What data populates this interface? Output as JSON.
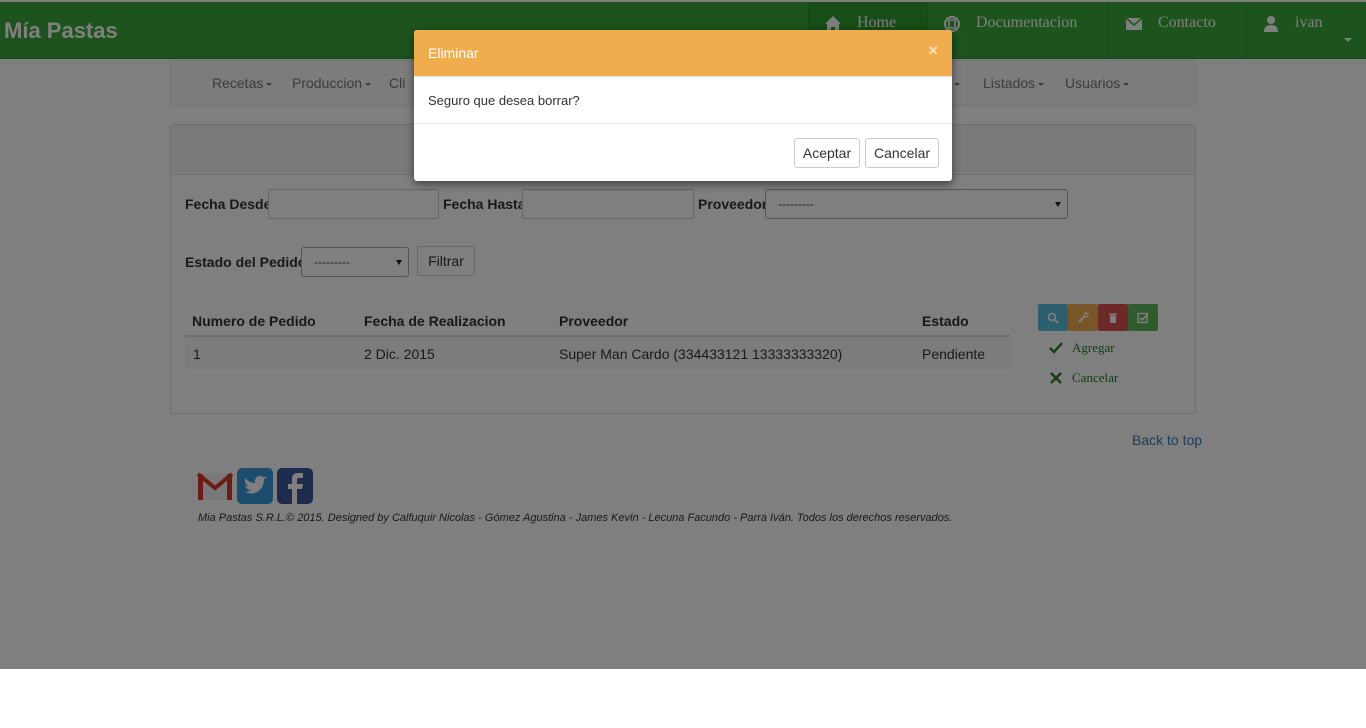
{
  "app": {
    "brand": "Mía Pastas"
  },
  "topnav": {
    "home": "Home",
    "docs": "Documentacion",
    "contact": "Contacto",
    "user": "ivan"
  },
  "submenu": {
    "items": [
      {
        "label": "Recetas"
      },
      {
        "label": "Produccion"
      },
      {
        "label": "Cli"
      },
      {
        "label": "Listados"
      },
      {
        "label": "Usuarios"
      }
    ]
  },
  "filters": {
    "fecha_desde_label": "Fecha Desde",
    "fecha_desde_value": "",
    "fecha_hasta_label": "Fecha Hasta",
    "fecha_hasta_value": "",
    "proveedor_label": "Proveedor",
    "proveedor_selected": "---------",
    "estado_label": "Estado del Pedido",
    "estado_selected": "---------",
    "filter_button": "Filtrar"
  },
  "table": {
    "headers": [
      "Numero de Pedido",
      "Fecha de Realizacion",
      "Proveedor",
      "Estado"
    ],
    "rows": [
      [
        "1",
        "2 Dic. 2015",
        "Super Man Cardo (334433121 13333333320)",
        "Pendiente"
      ]
    ]
  },
  "actions": {
    "agregar": "Agregar",
    "cancelar": "Cancelar"
  },
  "footer": {
    "back_to_top": "Back to top",
    "copyright": "Mia Pastas S.R.L.© 2015. Designed by Calfuquir Nicolas - Gómez Agustina - James Kevin - Lecuna Facundo - Parra Iván. Todos los derechos reservados."
  },
  "modal": {
    "title": "Eliminar",
    "close": "×",
    "message": "Seguro que desea borrar?",
    "accept": "Aceptar",
    "cancel": "Cancelar"
  },
  "colors": {
    "navbar": "#3aa63a",
    "modal_header": "#f0ad4e",
    "info": "#5bc0de",
    "warning": "#f0ad4e",
    "danger": "#d9534f",
    "success": "#5cb85c"
  }
}
